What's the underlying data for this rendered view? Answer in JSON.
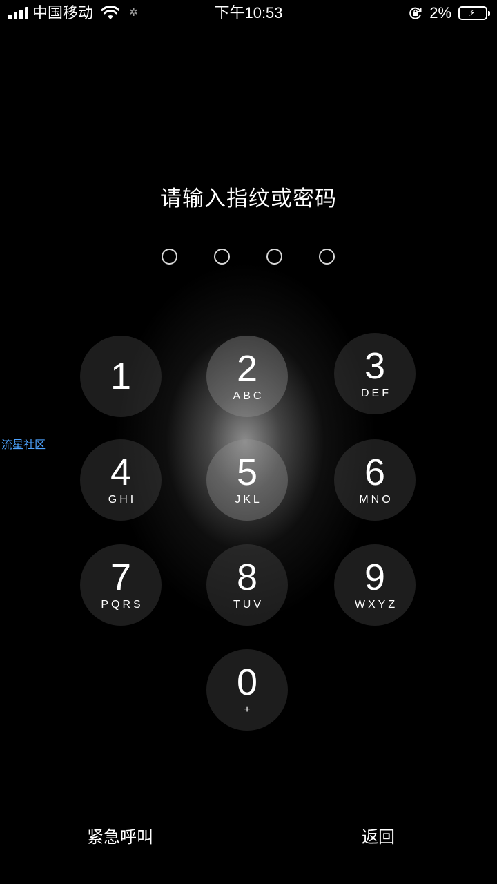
{
  "status_bar": {
    "carrier": "中国移动",
    "time": "下午10:53",
    "battery_percent": "2%",
    "battery_level": 0.02,
    "icons": [
      "signal-icon",
      "wifi-icon",
      "activity-spinner-icon",
      "rotation-lock-icon",
      "battery-charging-icon"
    ]
  },
  "prompt": "请输入指纹或密码",
  "passcode_length": 4,
  "keypad": [
    {
      "digit": "1",
      "letters": ""
    },
    {
      "digit": "2",
      "letters": "ABC"
    },
    {
      "digit": "3",
      "letters": "DEF"
    },
    {
      "digit": "4",
      "letters": "GHI"
    },
    {
      "digit": "5",
      "letters": "JKL"
    },
    {
      "digit": "6",
      "letters": "MNO"
    },
    {
      "digit": "7",
      "letters": "PQRS"
    },
    {
      "digit": "8",
      "letters": "TUV"
    },
    {
      "digit": "9",
      "letters": "WXYZ"
    },
    {
      "digit": "0",
      "letters": "+"
    }
  ],
  "watermark": "流星社区",
  "bottom": {
    "emergency": "紧急呼叫",
    "back": "返回"
  }
}
